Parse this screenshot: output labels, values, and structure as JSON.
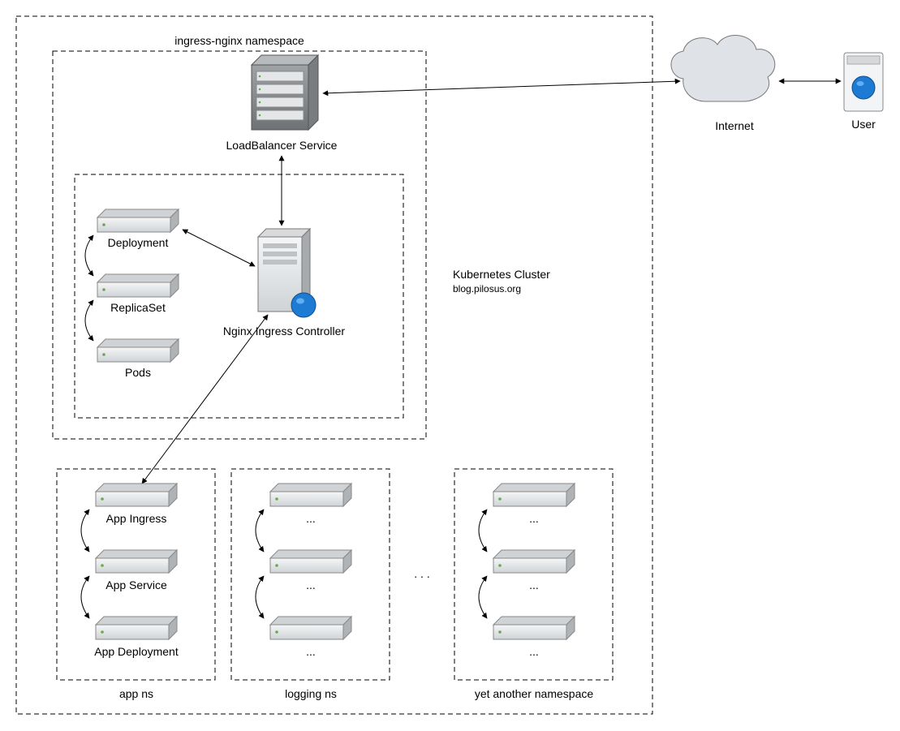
{
  "cluster": {
    "title": "Kubernetes Cluster",
    "subtitle": "blog.pilosus.org",
    "ingress_ns_label": "ingress-nginx namespace",
    "loadbalancer_label": "LoadBalancer Service",
    "deployment_label": "Deployment",
    "replicaset_label": "ReplicaSet",
    "pods_label": "Pods",
    "nic_label": "Nginx Ingress Controller",
    "app_ns": {
      "label": "app ns",
      "items": [
        "App Ingress",
        "App Service",
        "App Deployment"
      ]
    },
    "logging_ns": {
      "label": "logging ns",
      "items": [
        "...",
        "...",
        "..."
      ]
    },
    "other_ns": {
      "label": "yet another namespace",
      "items": [
        "...",
        "...",
        "..."
      ]
    },
    "between_ns_ellipsis": ". . ."
  },
  "external": {
    "internet_label": "Internet",
    "user_label": "User"
  }
}
